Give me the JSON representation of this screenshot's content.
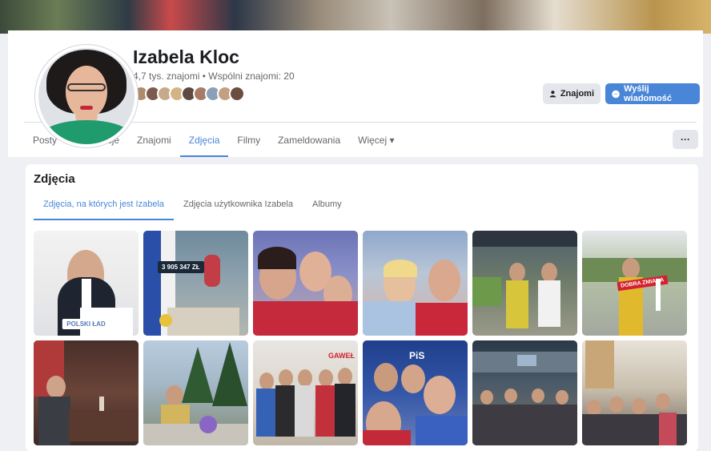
{
  "profile": {
    "name": "Izabela Kloc",
    "friends_summary": "4,7 tys. znajomi • Wspólni znajomi: 20",
    "friend_avatar_colors": [
      "#b08a6a",
      "#7d5a4f",
      "#c9a98c",
      "#d4b483",
      "#5e4a42",
      "#a67c66",
      "#8aa0b8",
      "#c4a080",
      "#6b4e3d"
    ]
  },
  "actions": {
    "friends_label": "Znajomi",
    "message_label": "Wyślij wiadomość"
  },
  "tabs": [
    {
      "label": "Posty"
    },
    {
      "label": "Informacje"
    },
    {
      "label": "Znajomi"
    },
    {
      "label": "Zdjęcia"
    },
    {
      "label": "Filmy"
    },
    {
      "label": "Zameldowania"
    },
    {
      "label": "Więcej ▾"
    }
  ],
  "more_label": "···",
  "photos_section": {
    "title": "Zdjęcia",
    "subtabs": [
      {
        "label": "Zdjęcia, na których jest Izabela"
      },
      {
        "label": "Zdjęcia użytkownika Izabela"
      },
      {
        "label": "Albumy"
      }
    ],
    "photo_texts": {
      "polski_lad": "POLSKI ŁAD",
      "amount": "3 905 347 ZŁ",
      "sign_red": "DOBRA ZMIANA",
      "gawel": "GAWEŁ",
      "pis": "PiS"
    }
  },
  "colors": {
    "accent": "#4a86d8",
    "card": "#ffffff",
    "background": "#eef0f3"
  }
}
